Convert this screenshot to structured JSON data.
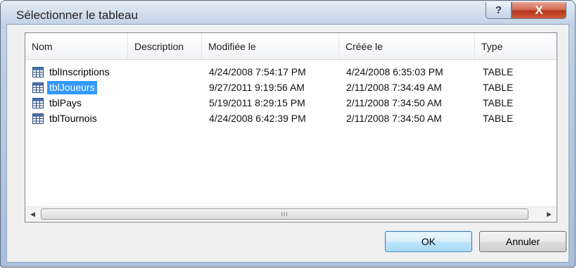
{
  "window": {
    "title": "Sélectionner le tableau",
    "help_label": "?",
    "close_label": "X"
  },
  "list": {
    "columns": [
      "Nom",
      "Description",
      "Modifiée le",
      "Créée le",
      "Type"
    ],
    "rows": [
      {
        "name": "tblInscriptions",
        "description": "",
        "modified": "4/24/2008 7:54:17 PM",
        "created": "4/24/2008 6:35:03 PM",
        "type": "TABLE",
        "selected": false
      },
      {
        "name": "tblJoueurs",
        "description": "",
        "modified": "9/27/2011 9:19:56 AM",
        "created": "2/11/2008 7:34:49 AM",
        "type": "TABLE",
        "selected": true
      },
      {
        "name": "tblPays",
        "description": "",
        "modified": "5/19/2011 8:29:15 PM",
        "created": "2/11/2008 7:34:50 AM",
        "type": "TABLE",
        "selected": false
      },
      {
        "name": "tblTournois",
        "description": "",
        "modified": "4/24/2008 6:42:39 PM",
        "created": "2/11/2008 7:34:50 AM",
        "type": "TABLE",
        "selected": false
      }
    ],
    "icon": "table-icon"
  },
  "scrollbar": {
    "left_arrow": "◀",
    "right_arrow": "▶",
    "grip": "III"
  },
  "buttons": {
    "ok_label": "OK",
    "cancel_label": "Annuler"
  },
  "colors": {
    "selection": "#3399ff",
    "title_gradient_top": "#e4ecf6",
    "close_button": "#c94a2e"
  }
}
